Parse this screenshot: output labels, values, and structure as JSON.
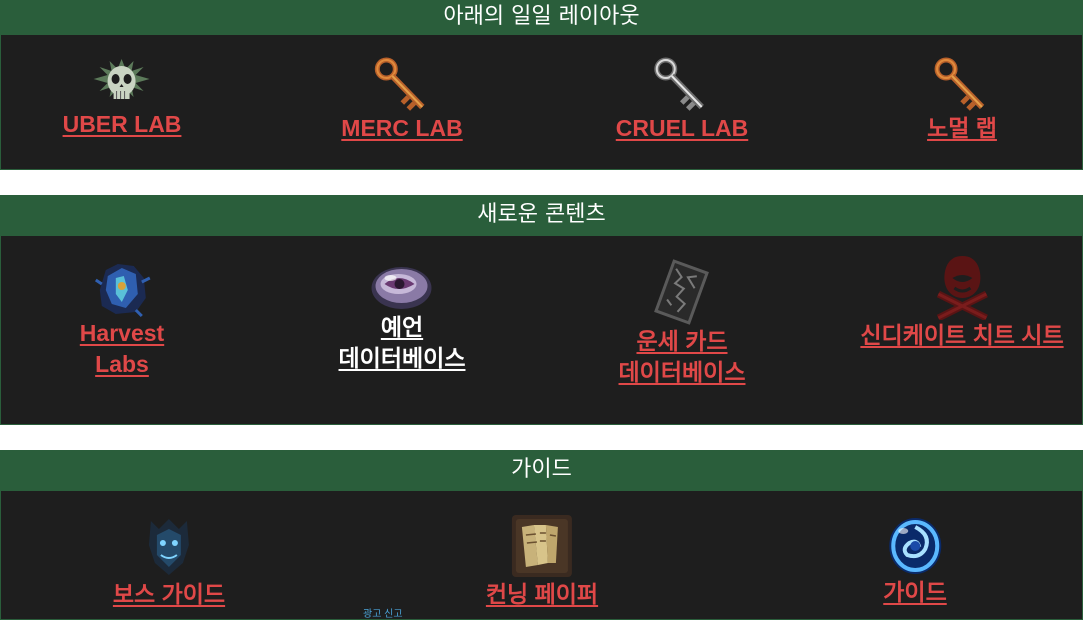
{
  "sections": [
    {
      "title": "아래의 일일 레이아웃",
      "items": [
        {
          "label": "UBER LAB",
          "icon": "skull-crest-icon"
        },
        {
          "label": "MERC LAB",
          "icon": "bronze-key-icon"
        },
        {
          "label": "CRUEL LAB",
          "icon": "silver-key-icon"
        },
        {
          "label": "노멀 랩",
          "icon": "bronze-key-icon"
        }
      ]
    },
    {
      "title": "새로운 콘텐츠",
      "items": [
        {
          "line1": "Harvest",
          "line2": "Labs",
          "icon": "harvest-crystal-icon"
        },
        {
          "line1": "예언",
          "line2": "데이터베이스",
          "icon": "prophecy-orb-icon"
        },
        {
          "line1": "운세 카드",
          "line2": "데이터베이스",
          "icon": "divination-card-icon"
        },
        {
          "label": "신디케이트 치트 시트",
          "icon": "syndicate-emblem-icon"
        }
      ]
    },
    {
      "title": "가이드",
      "items": [
        {
          "label": "보스 가이드",
          "icon": "boss-mask-icon"
        },
        {
          "label": "컨닝 페이퍼",
          "icon": "scroll-paper-icon"
        },
        {
          "label": "가이드",
          "icon": "blue-portal-icon"
        }
      ]
    }
  ],
  "ad_label": "광고 신고",
  "colors": {
    "header_green": "#2a5e3b",
    "panel_bg": "#1e1e1e",
    "link_red": "#e04848",
    "link_white": "#ffffff"
  }
}
